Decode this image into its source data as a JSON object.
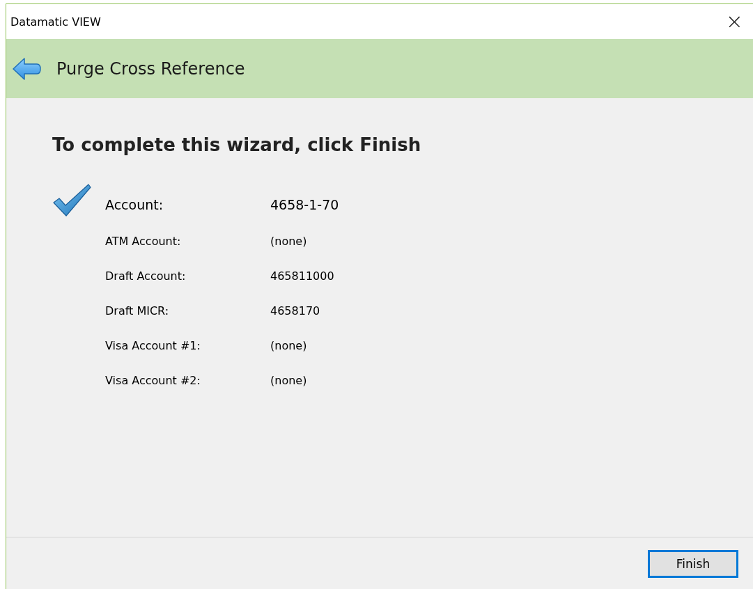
{
  "window": {
    "title": "Datamatic VIEW",
    "close": "×"
  },
  "header": {
    "title": "Purge Cross Reference"
  },
  "heading": "To complete this wizard, click Finish",
  "rows": [
    {
      "label": "Account:",
      "value": "4658-1-70",
      "primary": true
    },
    {
      "label": "ATM Account:",
      "value": "(none)",
      "primary": false
    },
    {
      "label": "Draft Account:",
      "value": "465811000",
      "primary": false
    },
    {
      "label": "Draft MICR:",
      "value": "4658170",
      "primary": false
    },
    {
      "label": "Visa Account #1:",
      "value": "(none)",
      "primary": false
    },
    {
      "label": "Visa Account #2:",
      "value": "(none)",
      "primary": false
    }
  ],
  "buttons": [
    {
      "label": "Finish",
      "focused": true
    }
  ]
}
